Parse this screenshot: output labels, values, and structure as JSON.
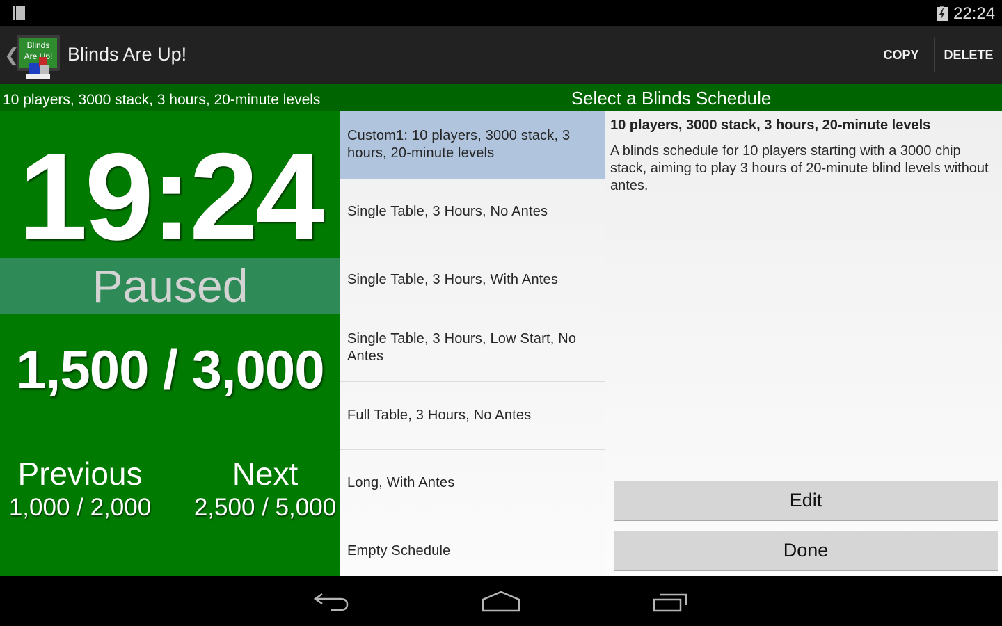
{
  "status_bar": {
    "left_icon": "notification-bars-icon",
    "battery_icon": "battery-charging-icon",
    "time": "22:24"
  },
  "action_bar": {
    "up_icon": "chevron-left-icon",
    "logo_icon": "blinds-are-up-logo",
    "logo_text_line1": "Blinds",
    "logo_text_line2": "Are Up!",
    "title": "Blinds Are Up!",
    "copy_label": "COPY",
    "delete_label": "DELETE"
  },
  "header": {
    "left_text": "10 players, 3000 stack, 3 hours, 20-minute levels",
    "right_text": "Select a Blinds Schedule"
  },
  "timer_panel": {
    "time_remaining": "19:24",
    "status": "Paused",
    "current_blinds": "1,500 / 3,000",
    "previous_label": "Previous",
    "previous_blinds": "1,000 / 2,000",
    "next_label": "Next",
    "next_blinds": "2,500 / 5,000"
  },
  "schedule_list": {
    "selected_index": 0,
    "items": [
      {
        "label": "Custom1: 10 players, 3000 stack, 3 hours, 20-minute levels"
      },
      {
        "label": "Single Table, 3 Hours, No Antes"
      },
      {
        "label": "Single Table, 3 Hours, With Antes"
      },
      {
        "label": "Single Table, 3 Hours, Low Start, No Antes"
      },
      {
        "label": "Full Table, 3 Hours, No Antes"
      },
      {
        "label": "Long, With Antes"
      },
      {
        "label": "Empty Schedule"
      }
    ]
  },
  "detail": {
    "title": "10 players, 3000 stack, 3 hours, 20-minute levels",
    "description": "A blinds schedule for 10 players starting with a 3000 chip stack, aiming to play 3 hours of 20-minute blind levels without antes.",
    "edit_label": "Edit",
    "done_label": "Done"
  },
  "nav_bar": {
    "back_icon": "back-icon",
    "home_icon": "home-icon",
    "recent_icon": "recent-apps-icon"
  },
  "colors": {
    "header_green": "#006400",
    "timer_green": "#007a00",
    "paused_band": "#2e8b57",
    "selected_item": "#b0c4de",
    "action_bar": "#222222"
  }
}
